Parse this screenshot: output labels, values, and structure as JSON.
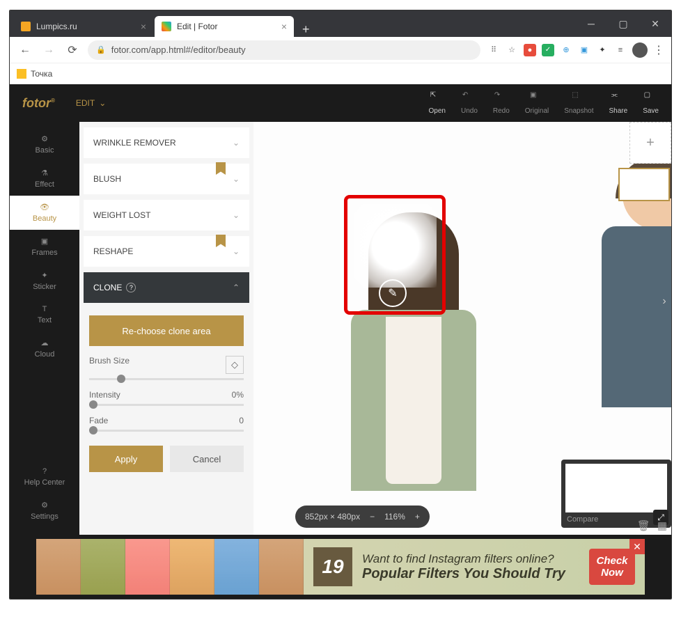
{
  "browser": {
    "tabs": [
      {
        "title": "Lumpics.ru",
        "active": false
      },
      {
        "title": "Edit | Fotor",
        "active": true
      }
    ],
    "url": "fotor.com/app.html#/editor/beauty",
    "bookmark": "Точка"
  },
  "app": {
    "logo": "fotor",
    "mode": "EDIT",
    "topbar": {
      "open": "Open",
      "undo": "Undo",
      "redo": "Redo",
      "original": "Original",
      "snapshot": "Snapshot",
      "share": "Share",
      "save": "Save"
    },
    "leftnav": {
      "basic": "Basic",
      "effect": "Effect",
      "beauty": "Beauty",
      "frames": "Frames",
      "sticker": "Sticker",
      "text": "Text",
      "cloud": "Cloud",
      "help": "Help Center",
      "settings": "Settings"
    },
    "tools": {
      "wrinkle": "WRINKLE REMOVER",
      "blush": "BLUSH",
      "weight": "WEIGHT LOST",
      "reshape": "RESHAPE",
      "clone": "CLONE"
    },
    "clone": {
      "rechoose": "Re-choose clone area",
      "brush_label": "Brush Size",
      "intensity_label": "Intensity",
      "intensity_value": "0%",
      "fade_label": "Fade",
      "fade_value": "0",
      "apply": "Apply",
      "cancel": "Cancel"
    },
    "canvas": {
      "dimensions": "852px × 480px",
      "zoom": "116%",
      "compare": "Compare"
    },
    "ad": {
      "number": "19",
      "line1": "Want to find Instagram filters online?",
      "line2": "Popular Filters You Should Try",
      "btn1": "Check",
      "btn2": "Now"
    }
  }
}
